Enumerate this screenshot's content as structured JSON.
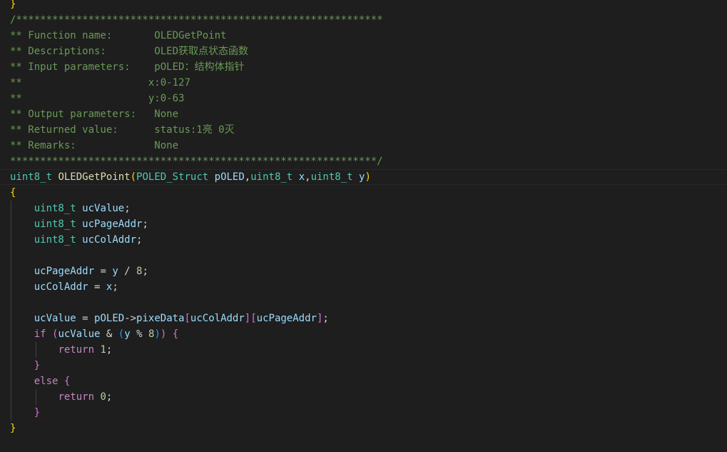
{
  "code": {
    "close_prev_brace": "}",
    "comment_open": "/*************************************************************",
    "c_fn_name_key": "** Function name:       ",
    "c_fn_name_val": "OLEDGetPoint",
    "c_desc_key": "** Descriptions:        ",
    "c_desc_val": "OLED获取点状态函数",
    "c_input_key": "** Input parameters:    ",
    "c_input_val": "pOLED：结构体指针",
    "c_x_key": "**                     ",
    "c_x_val": "x:0-127",
    "c_y_key": "**                     ",
    "c_y_val": "y:0-63",
    "c_output_key": "** Output parameters:   ",
    "c_output_val": "None",
    "c_return_key": "** Returned value:      ",
    "c_return_val": "status:1亮 0灭",
    "c_remarks_key": "** Remarks:             ",
    "c_remarks_val": "None",
    "comment_close": "*************************************************************/",
    "sig_ret_type": "uint8_t",
    "sig_fn": "OLEDGetPoint",
    "sig_paren_open": "(",
    "sig_p1_type": "POLED_Struct",
    "sig_p1_name": "pOLED",
    "sig_comma": ",",
    "sig_p2_type": "uint8_t",
    "sig_p2_name": "x",
    "sig_p3_type": "uint8_t",
    "sig_p3_name": "y",
    "sig_paren_close": ")",
    "body_open": "{",
    "decl_type": "uint8_t",
    "decl1_name": "ucValue",
    "decl2_name": "ucPageAddr",
    "decl3_name": "ucColAddr",
    "semi": ";",
    "a1_lhs": "ucPageAddr",
    "a1_eq": " = ",
    "a1_y": "y",
    "a1_div": " / ",
    "a1_num": "8",
    "a2_lhs": "ucColAddr",
    "a2_rhs": "x",
    "v_lhs": "ucValue",
    "v_p": "pOLED",
    "v_arrow": "->",
    "v_member": "pixeData",
    "br_open": "[",
    "br_close": "]",
    "if_kw": "if",
    "if_open": "(",
    "if_var": "ucValue",
    "if_and": " & ",
    "if_inner_open": "(",
    "if_y": "y",
    "if_mod": " % ",
    "if_num": "8",
    "if_inner_close": ")",
    "if_close": ")",
    "block_open": "{",
    "block_close": "}",
    "ret_kw": "return",
    "ret1": "1",
    "else_kw": "else",
    "ret0": "0",
    "body_close": "}"
  }
}
